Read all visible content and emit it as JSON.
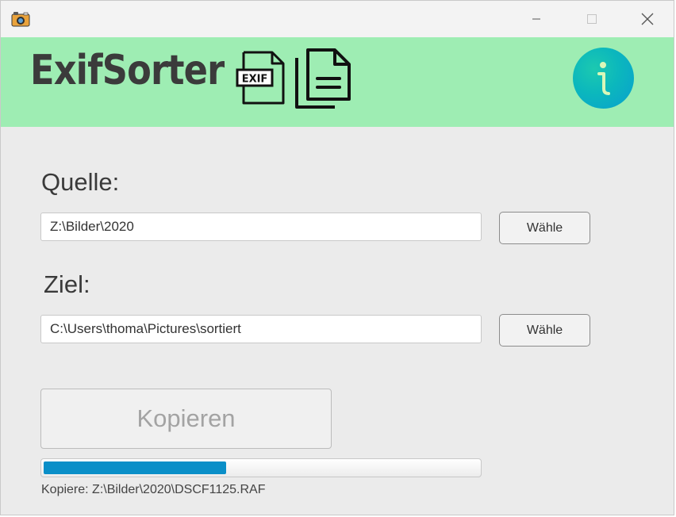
{
  "window": {
    "app_icon": "camera-icon",
    "controls": [
      "minimize-icon",
      "maximize-icon",
      "close-icon"
    ]
  },
  "header": {
    "title": "ExifSorter",
    "exif_badge": "EXIF",
    "info_icon": "info-icon",
    "banner_color": "#9eedb3"
  },
  "source": {
    "label": "Quelle:",
    "value": "Z:\\Bilder\\2020",
    "button_label": "Wähle"
  },
  "target": {
    "label": "Ziel:",
    "value": "C:\\Users\\thoma\\Pictures\\sortiert",
    "button_label": "Wähle"
  },
  "copy_button": {
    "label": "Kopieren",
    "enabled": false
  },
  "progress": {
    "fraction": 0.42,
    "color": "#0a8fc8"
  },
  "status": {
    "text": "Kopiere: Z:\\Bilder\\2020\\DSCF1125.RAF"
  }
}
